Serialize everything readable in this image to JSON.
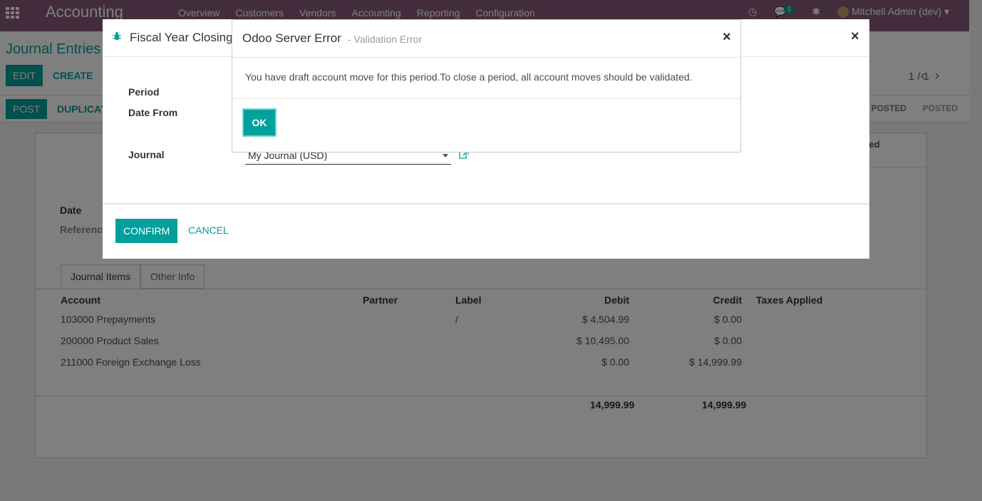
{
  "topnav": {
    "app_name": "Accounting",
    "menu": [
      "Overview",
      "Customers",
      "Vendors",
      "Accounting",
      "Reporting",
      "Configuration"
    ],
    "chat_badge": "1",
    "user": "Mitchell Admin (dev)"
  },
  "control": {
    "breadcrumb": "Journal Entries",
    "edit_label": "EDIT",
    "create_label": "CREATE",
    "pager": "1 / 1",
    "post_label": "POST",
    "duplicate_label": "DUPLICAT",
    "stages": [
      "POSTED",
      "POSTED"
    ]
  },
  "form": {
    "smart_button": "onciled\nies",
    "date_label": "Date",
    "reference_label": "Reference",
    "tabs": [
      "Journal Items",
      "Other Info"
    ],
    "columns": [
      "Account",
      "Partner",
      "Label",
      "Debit",
      "Credit",
      "Taxes Applied"
    ],
    "rows": [
      {
        "account": "103000 Prepayments",
        "partner": "",
        "label": "/",
        "debit": "$ 4,504.99",
        "credit": "$ 0.00",
        "taxes": ""
      },
      {
        "account": "200000 Product Sales",
        "partner": "",
        "label": "",
        "debit": "$ 10,495.00",
        "credit": "$ 0.00",
        "taxes": ""
      },
      {
        "account": "211000 Foreign Exchange Loss",
        "partner": "",
        "label": "",
        "debit": "$ 0.00",
        "credit": "$ 14,999.99",
        "taxes": ""
      }
    ],
    "total_debit": "14,999.99",
    "total_credit": "14,999.99"
  },
  "fiscal_dialog": {
    "title": "Fiscal Year Closing",
    "period_label": "Period",
    "date_from_label": "Date From",
    "journal_label": "Journal",
    "journal_value": "My Journal (USD)",
    "confirm_label": "CONFIRM",
    "cancel_label": "CANCEL",
    "close_symbol": "×"
  },
  "error_dialog": {
    "title": "Odoo Server Error",
    "subtitle": "- Validation Error",
    "message": "You have draft account move for this period.To close a period, all account moves should be validated.",
    "ok_label": "OK",
    "close_symbol": "×"
  }
}
